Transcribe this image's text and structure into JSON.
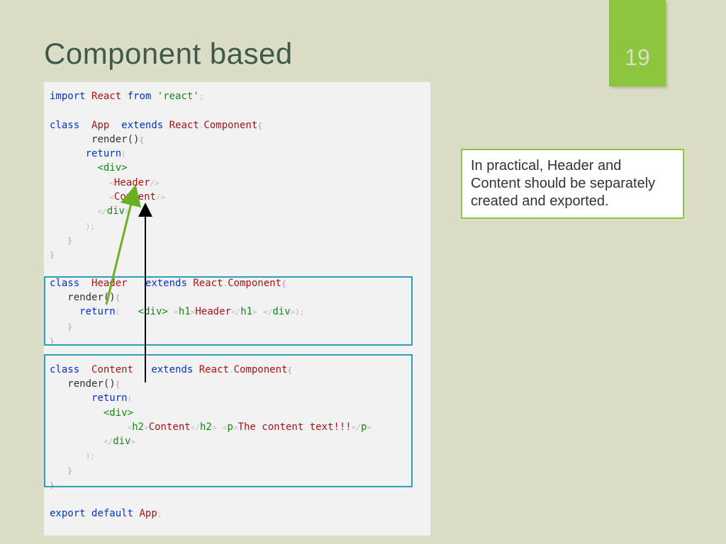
{
  "page_number": "19",
  "title": "Component based",
  "note": "In practical, Header and Content should be separately created and exported.",
  "code": {
    "l1_import": "import",
    "l1_react": "React",
    "l1_from": "from",
    "l1_str": "'react'",
    "l2_class": "class",
    "l2_app": "App",
    "l2_extends": "extends",
    "l2_rc": "React",
    "l2_comp": "Component",
    "render": "render()",
    "return": "return",
    "div_open": "<div>",
    "div_close": "div",
    "header_tag": "Header",
    "content_tag": "Content",
    "hdr_class": "class",
    "hdr_name": "Header",
    "hdr_extends": "extends",
    "hdr_rc": "React",
    "hdr_comp": "Component",
    "h1": "h1",
    "header_txt": "Header",
    "cnt_class": "class",
    "cnt_name": "Content",
    "cnt_extends": "extends",
    "cnt_rc": "React",
    "cnt_comp": "Component",
    "h2": "h2",
    "content_txt": "Content",
    "p": "p",
    "body_txt": "The content text!!!",
    "export": "export",
    "default": "default",
    "export_app": "App"
  }
}
